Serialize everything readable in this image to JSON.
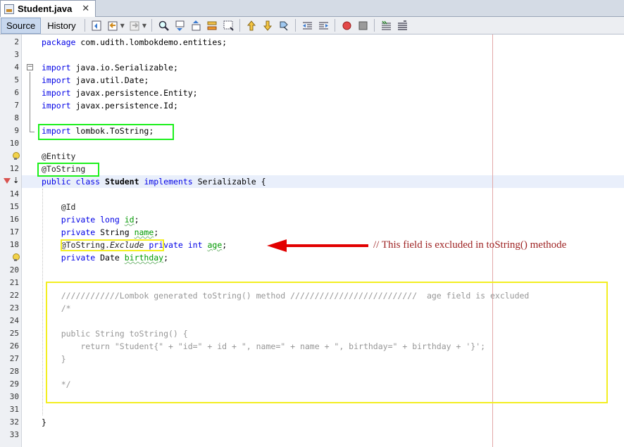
{
  "tab": {
    "title": "Student.java",
    "close": "✕"
  },
  "toolbar": {
    "source_label": "Source",
    "history_label": "History",
    "icons": [
      "last-edit-icon",
      "back-icon",
      "forward-icon",
      "find-icon",
      "find-previous-icon",
      "find-next-icon",
      "find-selection-icon",
      "toggle-highlight-icon",
      "toggle-rectangular-icon",
      "previous-bookmark-icon",
      "next-bookmark-icon",
      "toggle-bookmark-icon",
      "shift-left-icon",
      "shift-right-icon",
      "start-macro-icon",
      "stop-macro-icon",
      "comment-icon",
      "uncomment-icon"
    ]
  },
  "editor": {
    "lines": [
      {
        "num": "2",
        "segments": [
          {
            "t": "package",
            "c": "kw"
          },
          {
            "t": " com.udith.lombokdemo.entities;",
            "c": ""
          }
        ]
      },
      {
        "num": "3",
        "segments": []
      },
      {
        "num": "4",
        "segments": [
          {
            "t": "import",
            "c": "kw"
          },
          {
            "t": " java.io.Serializable;",
            "c": ""
          }
        ]
      },
      {
        "num": "5",
        "segments": [
          {
            "t": "import",
            "c": "kw"
          },
          {
            "t": " java.util.Date;",
            "c": ""
          }
        ]
      },
      {
        "num": "6",
        "segments": [
          {
            "t": "import",
            "c": "kw"
          },
          {
            "t": " javax.persistence.Entity;",
            "c": ""
          }
        ]
      },
      {
        "num": "7",
        "segments": [
          {
            "t": "import",
            "c": "kw"
          },
          {
            "t": " javax.persistence.Id;",
            "c": ""
          }
        ]
      },
      {
        "num": "8",
        "segments": []
      },
      {
        "num": "9",
        "segments": [
          {
            "t": "import",
            "c": "kw"
          },
          {
            "t": " lombok.ToString;",
            "c": ""
          }
        ]
      },
      {
        "num": "10",
        "segments": []
      },
      {
        "num": "",
        "segments": [
          {
            "t": "@Entity",
            "c": "ann"
          }
        ]
      },
      {
        "num": "12",
        "segments": [
          {
            "t": "@ToString",
            "c": "ann"
          }
        ]
      },
      {
        "num": "",
        "segments": [
          {
            "t": "public",
            "c": "kw"
          },
          {
            "t": " ",
            "c": ""
          },
          {
            "t": "class",
            "c": "kw"
          },
          {
            "t": " ",
            "c": ""
          },
          {
            "t": "Student",
            "c": "cls"
          },
          {
            "t": " ",
            "c": ""
          },
          {
            "t": "implements",
            "c": "kw"
          },
          {
            "t": " Serializable {",
            "c": ""
          }
        ]
      },
      {
        "num": "14",
        "segments": []
      },
      {
        "num": "15",
        "segments": [
          {
            "t": "    @Id",
            "c": "ann"
          }
        ]
      },
      {
        "num": "16",
        "segments": [
          {
            "t": "    ",
            "c": ""
          },
          {
            "t": "private",
            "c": "kw"
          },
          {
            "t": " ",
            "c": ""
          },
          {
            "t": "long",
            "c": "kw"
          },
          {
            "t": " ",
            "c": ""
          },
          {
            "t": "id",
            "c": "fld"
          },
          {
            "t": ";",
            "c": ""
          }
        ]
      },
      {
        "num": "17",
        "segments": [
          {
            "t": "    ",
            "c": ""
          },
          {
            "t": "private",
            "c": "kw"
          },
          {
            "t": " String ",
            "c": ""
          },
          {
            "t": "name",
            "c": "fld"
          },
          {
            "t": ";",
            "c": ""
          }
        ]
      },
      {
        "num": "18",
        "segments": [
          {
            "t": "    @ToString.",
            "c": "ann"
          },
          {
            "t": "Exclude",
            "c": "ann ital"
          },
          {
            "t": " ",
            "c": ""
          },
          {
            "t": "private",
            "c": "kw"
          },
          {
            "t": " ",
            "c": ""
          },
          {
            "t": "int",
            "c": "kw"
          },
          {
            "t": " ",
            "c": ""
          },
          {
            "t": "age",
            "c": "fld"
          },
          {
            "t": ";",
            "c": ""
          }
        ]
      },
      {
        "num": "",
        "segments": [
          {
            "t": "    ",
            "c": ""
          },
          {
            "t": "private",
            "c": "kw"
          },
          {
            "t": " Date ",
            "c": ""
          },
          {
            "t": "birthday",
            "c": "fld"
          },
          {
            "t": ";",
            "c": ""
          }
        ]
      },
      {
        "num": "20",
        "segments": []
      },
      {
        "num": "21",
        "segments": []
      },
      {
        "num": "22",
        "segments": [
          {
            "t": "    ////////////Lombok generated toString() method //////////////////////////  age field is excluded",
            "c": "cm"
          }
        ]
      },
      {
        "num": "23",
        "segments": [
          {
            "t": "    /*",
            "c": "cm"
          }
        ]
      },
      {
        "num": "24",
        "segments": []
      },
      {
        "num": "25",
        "segments": [
          {
            "t": "    public String toString() {",
            "c": "cm"
          }
        ]
      },
      {
        "num": "26",
        "segments": [
          {
            "t": "        return \"Student{\" + \"id=\" + id + \", name=\" + name + \", birthday=\" + birthday + '}';",
            "c": "cm"
          }
        ]
      },
      {
        "num": "27",
        "segments": [
          {
            "t": "    }",
            "c": "cm"
          }
        ]
      },
      {
        "num": "28",
        "segments": []
      },
      {
        "num": "29",
        "segments": [
          {
            "t": "    */",
            "c": "cm"
          }
        ]
      },
      {
        "num": "30",
        "segments": []
      },
      {
        "num": "31",
        "segments": []
      },
      {
        "num": "32",
        "segments": [
          {
            "t": "}",
            "c": ""
          }
        ]
      },
      {
        "num": "33",
        "segments": []
      }
    ]
  },
  "annotation": {
    "note": "// This field is excluded in toString() methode",
    "arrow_color": "#e20000",
    "note_color": "#9e2323"
  },
  "colors": {
    "keyword": "#0000e6",
    "field": "#009900",
    "comment": "#969696",
    "green_box": "#1cf01c",
    "yellow_box": "#f3ee21"
  }
}
